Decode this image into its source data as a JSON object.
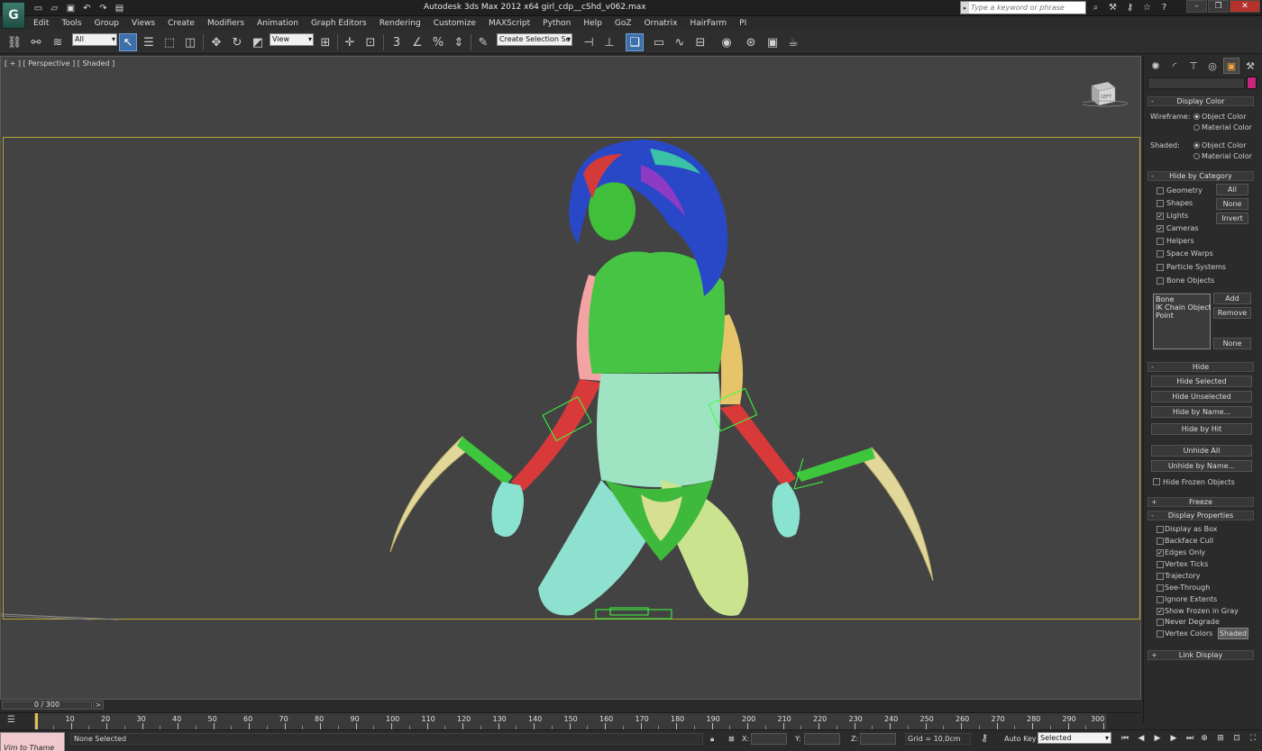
{
  "window": {
    "title": "Autodesk 3ds Max  2012 x64     girl_cdp__cShd_v062.max",
    "search_placeholder": "Type a keyword or phrase",
    "controls": [
      "–",
      "❐",
      "✕"
    ],
    "app_logo": "G"
  },
  "menu": [
    "Edit",
    "Tools",
    "Group",
    "Views",
    "Create",
    "Modifiers",
    "Animation",
    "Graph Editors",
    "Rendering",
    "Customize",
    "MAXScript",
    "Python",
    "Help",
    "GoZ",
    "Ornatrix",
    "HairFarm",
    "PI"
  ],
  "toolbar": {
    "selection_filter": "All",
    "ref_coord": "View",
    "named_selection": "Create Selection Se",
    "snap_3": "3",
    "angle_snap": "∠",
    "percent_snap": "%"
  },
  "viewport": {
    "label": "[ + ] [ Perspective ] [ Shaded ]",
    "viewcube_label": "LEFT"
  },
  "command_panel": {
    "display_color": {
      "title": "Display Color",
      "wireframe_label": "Wireframe:",
      "shaded_label": "Shaded:",
      "options": [
        "Object Color",
        "Material Color"
      ],
      "wireframe_selected": "Object Color",
      "shaded_selected": "Object Color"
    },
    "hide_by_category": {
      "title": "Hide by Category",
      "items": [
        {
          "label": "Geometry",
          "checked": false
        },
        {
          "label": "Shapes",
          "checked": false
        },
        {
          "label": "Lights",
          "checked": true
        },
        {
          "label": "Cameras",
          "checked": true
        },
        {
          "label": "Helpers",
          "checked": false
        },
        {
          "label": "Space Warps",
          "checked": false
        },
        {
          "label": "Particle Systems",
          "checked": false
        },
        {
          "label": "Bone Objects",
          "checked": false
        }
      ],
      "buttons": [
        "All",
        "None",
        "Invert"
      ],
      "list": [
        "Bone",
        "IK Chain Object",
        "Point"
      ],
      "list_buttons": [
        "Add",
        "Remove",
        "None"
      ]
    },
    "hide": {
      "title": "Hide",
      "buttons": [
        "Hide Selected",
        "Hide Unselected",
        "Hide by Name...",
        "Hide by Hit",
        "Unhide All",
        "Unhide by Name..."
      ],
      "hide_frozen": {
        "label": "Hide Frozen Objects",
        "checked": false
      }
    },
    "freeze": {
      "title": "Freeze"
    },
    "display_properties": {
      "title": "Display Properties",
      "items": [
        {
          "label": "Display as Box",
          "checked": false
        },
        {
          "label": "Backface Cull",
          "checked": false
        },
        {
          "label": "Edges Only",
          "checked": true
        },
        {
          "label": "Vertex Ticks",
          "checked": false
        },
        {
          "label": "Trajectory",
          "checked": false
        },
        {
          "label": "See-Through",
          "checked": false
        },
        {
          "label": "Ignore Extents",
          "checked": false
        },
        {
          "label": "Show Frozen in Gray",
          "checked": true
        },
        {
          "label": "Never Degrade",
          "checked": false
        },
        {
          "label": "Vertex Colors",
          "checked": false
        }
      ],
      "shaded_button": "Shaded"
    },
    "link_display": {
      "title": "Link Display"
    }
  },
  "timeline": {
    "frame": "0 / 300",
    "next": ">",
    "ticks": [
      "10",
      "20",
      "30",
      "40",
      "50",
      "60",
      "70",
      "80",
      "90",
      "100",
      "110",
      "120",
      "130",
      "140",
      "150",
      "160",
      "170",
      "180",
      "190",
      "200",
      "210",
      "220",
      "230",
      "240",
      "250",
      "260",
      "270",
      "280",
      "290",
      "300"
    ]
  },
  "status": {
    "maxscript": "Vim to Thame",
    "selection": "None Selected",
    "x_label": "X:",
    "y_label": "Y:",
    "z_label": "Z:",
    "grid": "Grid = 10,0cm",
    "auto_key": "Auto Key",
    "set_key_mode": "Selected"
  },
  "colors": {
    "safe_frame": "#b9a232",
    "active_tool": "#3d6fa8",
    "object_color": "#c7287d",
    "skin": "#3fbf3a",
    "helpers": "#3cff3c"
  }
}
